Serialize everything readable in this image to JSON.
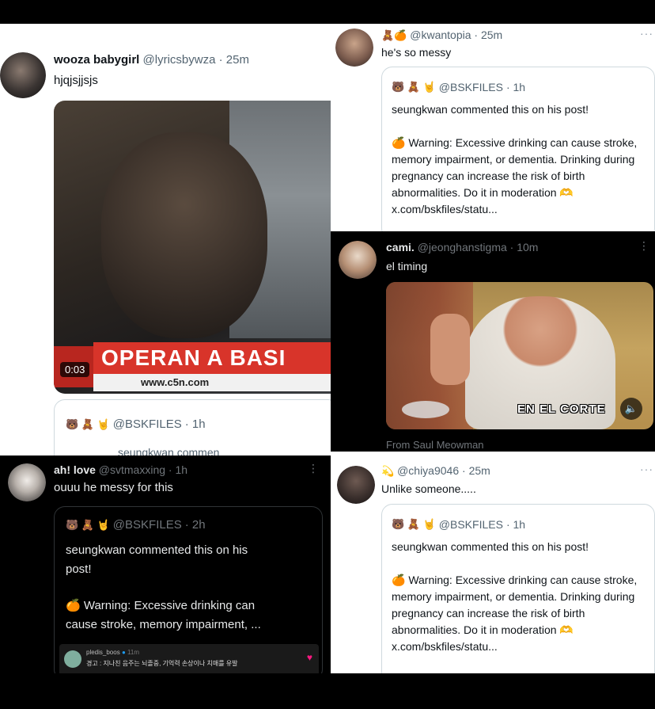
{
  "top_left": {
    "name": "wooza babygirl",
    "handle": "@lyricsbywza",
    "time": "· 25m",
    "text": "hjqjsjjsjs",
    "video": {
      "caption": "OPERAN A BASI",
      "site": "www.c5n.com",
      "duration": "0:03"
    },
    "quote": {
      "emojis": "🐻 🧸 🤘",
      "handle": "@BSKFILES",
      "time": "· 1h",
      "text": "seungkwan commen"
    }
  },
  "top_right": {
    "emojis": "🧸🍊",
    "handle": "@kwantopia",
    "time": "· 25m",
    "text": "he's so messy",
    "quote": {
      "emojis": "🐻 🧸 🤘",
      "handle": "@BSKFILES",
      "time": "· 1h",
      "line1": "seungkwan commented this on his post!",
      "body": "🍊 Warning: Excessive drinking can cause stroke, memory impairment, or dementia. Drinking during pregnancy can increase the risk of birth abnormalities. Do it in moderation 🫶 x.com/bskfiles/statu..."
    }
  },
  "middle_right": {
    "name": "cami.",
    "handle": "@jeonghanstigma",
    "time": "· 10m",
    "text": "el timing",
    "video": {
      "caption": "EN EL CORTE",
      "source": "From Saul Meowman"
    }
  },
  "bottom_left": {
    "name": "ah! love",
    "handle": "@svtmaxxing",
    "time": "· 1h",
    "text": "ouuu he messy for this",
    "quote": {
      "emojis": "🐻 🧸 🤘",
      "handle": "@BSKFILES",
      "time": "· 2h",
      "line1": "seungkwan commented this on his",
      "line2": "post!",
      "body1": "🍊 Warning: Excessive drinking can",
      "body2": "cause stroke, memory impairment, ...",
      "embedded_user": "pledis_boos",
      "embedded_time": "11m",
      "embedded_text": "경고 : 지나친 음주는 뇌졸중, 기억력 손상이나 치매를 유발"
    }
  },
  "bottom_right": {
    "emojis": "💫",
    "handle": "@chiya9046",
    "time": "· 25m",
    "text": "Unlike someone.....",
    "quote": {
      "emojis": "🐻 🧸 🤘",
      "handle": "@BSKFILES",
      "time": "· 1h",
      "line1": "seungkwan commented this on his post!",
      "body": "🍊 Warning: Excessive drinking can cause stroke, memory impairment, or dementia. Drinking during pregnancy can increase the risk of birth abnormalities. Do it in moderation 🫶 x.com/bskfiles/statu..."
    }
  },
  "icons": {
    "more": "more-icon",
    "mute": "speaker-icon"
  },
  "colors": {
    "light_bg": "#ffffff",
    "dark_bg": "#000000",
    "muted_text": "#536471",
    "news_red": "#d8342a"
  }
}
